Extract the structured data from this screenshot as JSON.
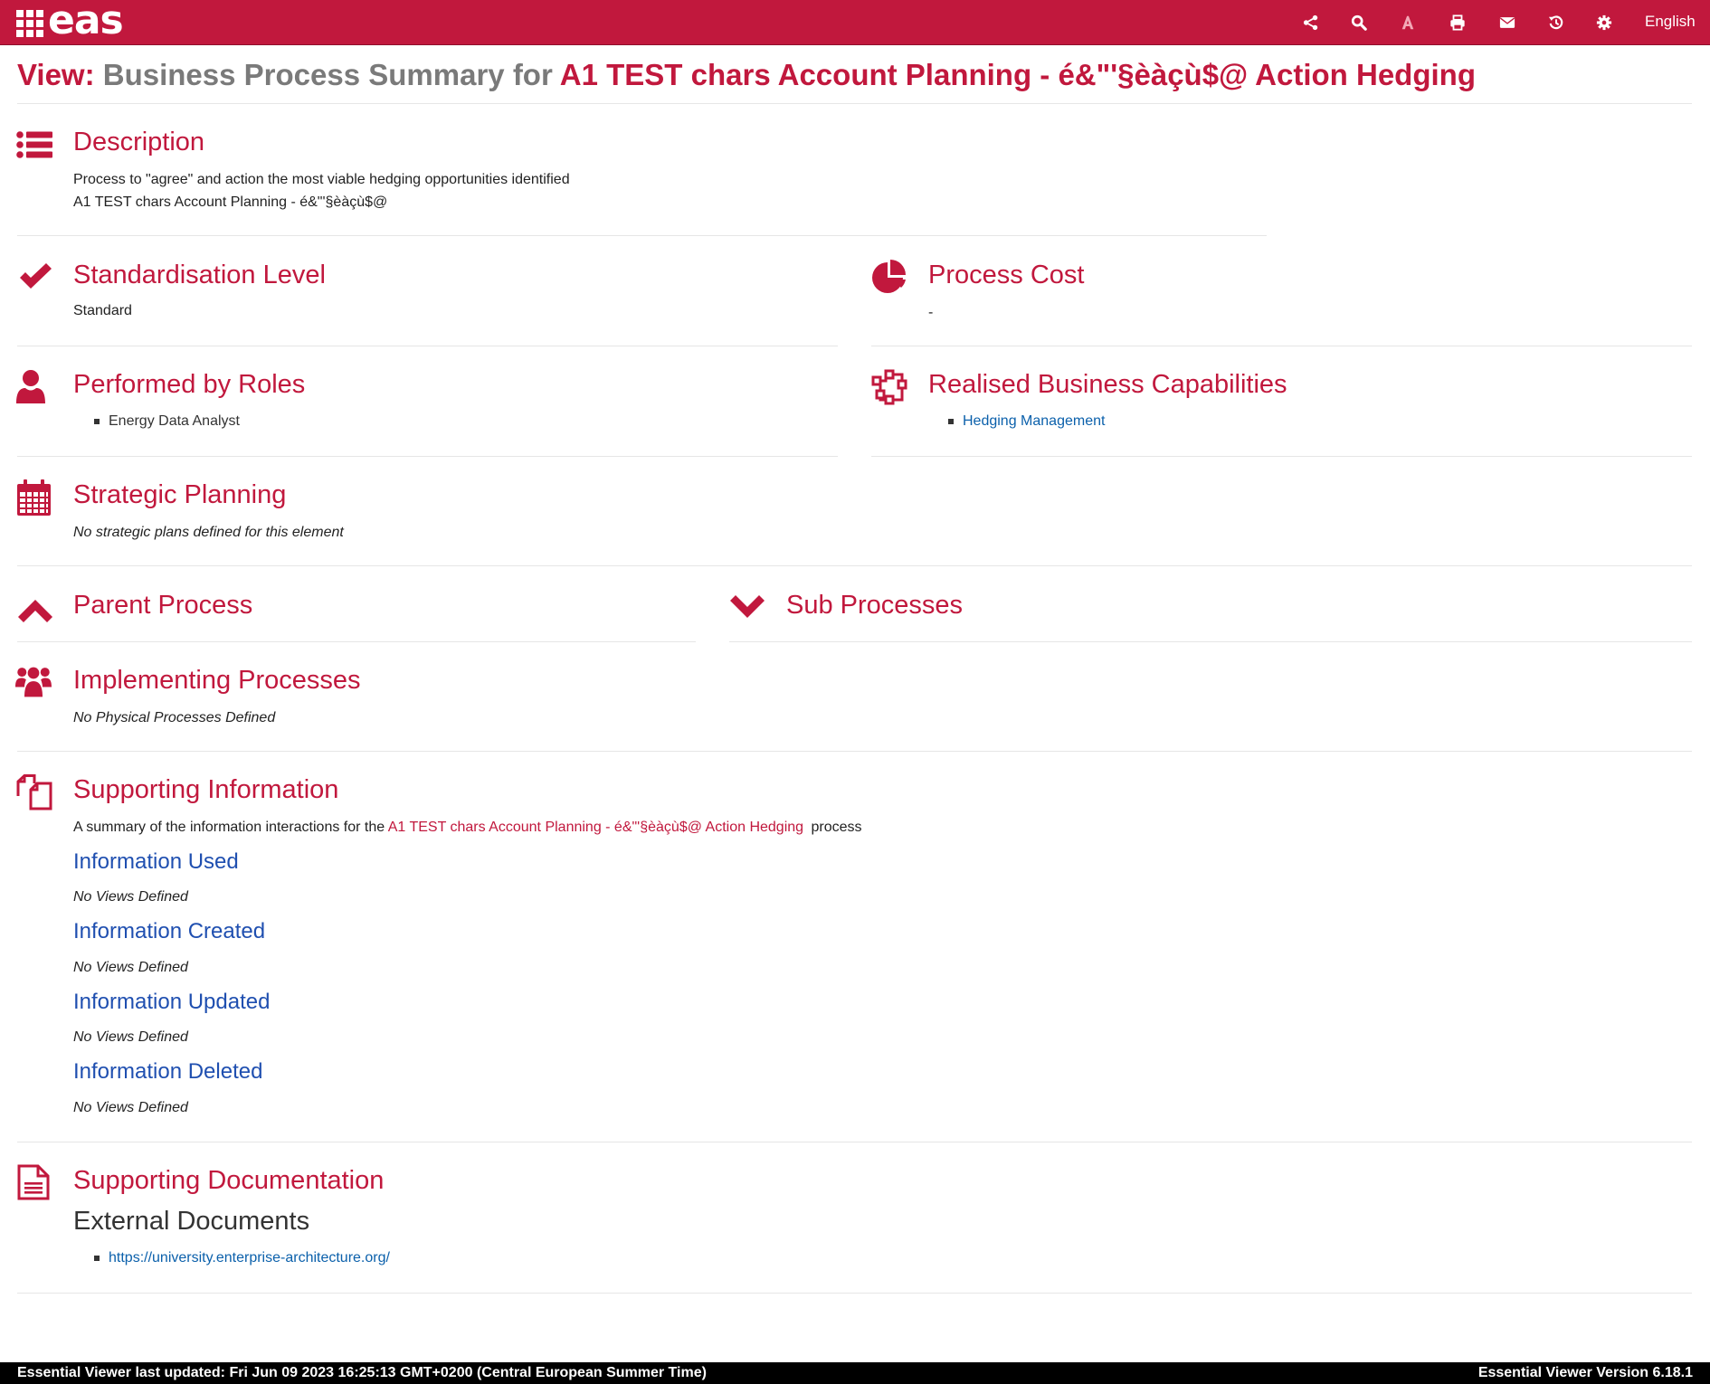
{
  "header": {
    "brand": "eas",
    "language": "English",
    "icons": [
      "share-icon",
      "search-icon",
      "font-icon",
      "print-icon",
      "mail-icon",
      "history-icon",
      "settings-icon"
    ],
    "colors": {
      "bar": "#c1183d",
      "accent": "#c1183d",
      "link": "#0b60ab"
    }
  },
  "page_title": {
    "label": "View:",
    "middle": "Business Process Summary for",
    "entity": "A1 TEST chars Account Planning - é&\"'§èàçù$@ Action Hedging"
  },
  "description": {
    "title": "Description",
    "line1": "Process to \"agree\" and action the most viable hedging opportunities identified",
    "line2": "A1 TEST chars Account Planning - é&\"'§èàçù$@"
  },
  "standardisation": {
    "title": "Standardisation Level",
    "value": "Standard"
  },
  "process_cost": {
    "title": "Process Cost",
    "value": "-"
  },
  "roles": {
    "title": "Performed by Roles",
    "items": [
      "Energy Data Analyst"
    ]
  },
  "capabilities": {
    "title": "Realised Business Capabilities",
    "items": [
      "Hedging Management"
    ]
  },
  "strategic_planning": {
    "title": "Strategic Planning",
    "message": "No strategic plans defined for this element"
  },
  "parent_process": {
    "title": "Parent Process"
  },
  "sub_processes": {
    "title": "Sub Processes"
  },
  "implementing": {
    "title": "Implementing Processes",
    "message": "No Physical Processes Defined"
  },
  "supporting_info": {
    "title": "Supporting Information",
    "summary_prefix": "A summary of the information interactions for the",
    "summary_entity": "A1 TEST chars Account Planning - é&\"'§èàçù$@ Action Hedging",
    "summary_suffix": "process",
    "groups": [
      {
        "title": "Information Used",
        "message": "No Views Defined"
      },
      {
        "title": "Information Created",
        "message": "No Views Defined"
      },
      {
        "title": "Information Updated",
        "message": "No Views Defined"
      },
      {
        "title": "Information Deleted",
        "message": "No Views Defined"
      }
    ]
  },
  "supporting_docs": {
    "title": "Supporting Documentation",
    "subtitle": "External Documents",
    "links": [
      "https://university.enterprise-architecture.org/"
    ]
  },
  "footer": {
    "left": "Essential Viewer last updated: Fri Jun 09 2023 16:25:13 GMT+0200 (Central European Summer Time)",
    "right": "Essential Viewer Version 6.18.1"
  }
}
